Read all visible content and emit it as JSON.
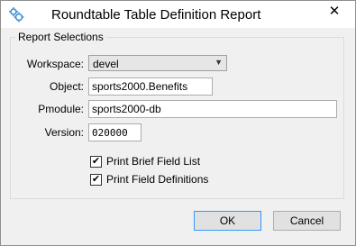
{
  "window": {
    "title": "Roundtable Table Definition Report",
    "app_icon": "gear-cluster-icon",
    "close_glyph": "✕"
  },
  "report_selections": {
    "legend": "Report Selections",
    "workspace": {
      "label": "Workspace:",
      "value": "devel"
    },
    "object": {
      "label": "Object:",
      "value": "sports2000.Benefits"
    },
    "pmodule": {
      "label": "Pmodule:",
      "value": "sports2000-db"
    },
    "version": {
      "label": "Version:",
      "value": "020000"
    },
    "print_brief": {
      "label": "Print Brief Field List",
      "checked": true
    },
    "print_defs": {
      "label": "Print Field Definitions",
      "checked": true
    }
  },
  "buttons": {
    "ok": "OK",
    "cancel": "Cancel"
  },
  "colors": {
    "accent": "#3399ff",
    "icon": "#3a8fd8"
  }
}
